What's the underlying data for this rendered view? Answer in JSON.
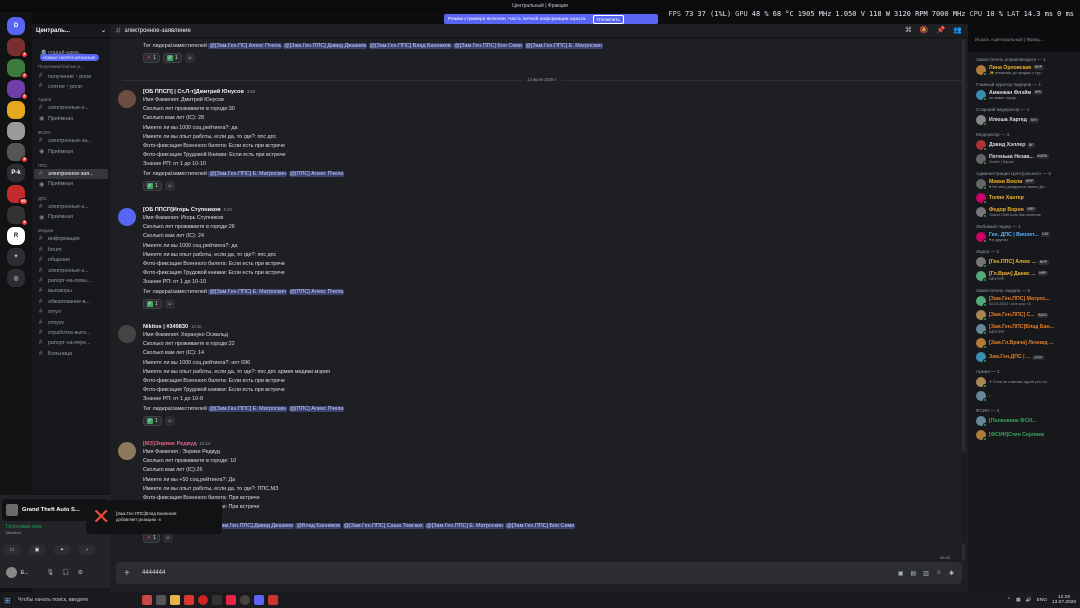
{
  "window": {
    "title": "Центральный | Фракции"
  },
  "overlay": {
    "fps_label": "FPS",
    "fps": "73",
    "fps_low": "37 (1%L)",
    "gpu_label": "GPU",
    "gpu_load": "48 %",
    "gpu_temp": "68 °C",
    "gpu_clock": "1905 MHz",
    "gpu_volt": "1.050 V",
    "gpu_power": "118 W",
    "gpu_rpm": "3120 RPM",
    "gpu_mem": "7000 MHz",
    "cpu_label": "CPU",
    "cpu_load": "10 %",
    "lat_label": "LAT",
    "lat": "14.3 ms",
    "lat2": "0 ms"
  },
  "streamer_notice": {
    "text": "Режим стримера включен. Часть личной информации скрыта.",
    "button": "Отключить"
  },
  "servers": [
    {
      "label": "D",
      "color": "#5865f2",
      "badge": ""
    },
    {
      "label": "",
      "color": "#7a2f2f",
      "badge": "1"
    },
    {
      "label": "",
      "color": "#3d7a3d",
      "badge": "1"
    },
    {
      "label": "",
      "color": "#6f3ea8",
      "badge": "8"
    },
    {
      "label": "",
      "color": "#e6a620",
      "badge": ""
    },
    {
      "label": "",
      "color": "#9a9a9a",
      "badge": ""
    },
    {
      "label": "",
      "color": "#555",
      "badge": "5"
    },
    {
      "label": "P-k",
      "color": "#2b2d31",
      "badge": ""
    },
    {
      "label": "",
      "color": "#c02b2b",
      "badge": "60"
    },
    {
      "label": "",
      "color": "#333",
      "badge": "1"
    },
    {
      "label": "R",
      "color": "#fff",
      "badge": ""
    },
    {
      "label": "+",
      "color": "#2b2d31",
      "badge": ""
    },
    {
      "label": "◎",
      "color": "#2b2d31",
      "badge": ""
    }
  ],
  "server_name": "Централь...",
  "new_unread": "НОВЫЕ НЕПРОЧИТАННЫЕ",
  "channel_list": [
    {
      "type": "ch",
      "label": "угадай-адми...",
      "icon": "🔎"
    },
    {
      "type": "cat",
      "label": "Получение/Снятие р..."
    },
    {
      "type": "ch",
      "label": "получение・роли"
    },
    {
      "type": "ch",
      "label": "снятие・роли"
    },
    {
      "type": "cat",
      "label": "Армия"
    },
    {
      "type": "ch",
      "label": "электронные-з..."
    },
    {
      "type": "ch",
      "label": "Приёмная",
      "icon": "◉"
    },
    {
      "type": "cat",
      "label": "ФСИН"
    },
    {
      "type": "ch",
      "label": "электронные-за..."
    },
    {
      "type": "ch",
      "label": "Приёмная",
      "icon": "◉"
    },
    {
      "type": "cat",
      "label": "ППС"
    },
    {
      "type": "ch",
      "label": "электронное-зая...",
      "active": true
    },
    {
      "type": "ch",
      "label": "Приёмная",
      "icon": "◉"
    },
    {
      "type": "cat",
      "label": "ДПС"
    },
    {
      "type": "ch",
      "label": "электронные-з..."
    },
    {
      "type": "ch",
      "label": "Приёмная",
      "icon": "◉"
    },
    {
      "type": "cat",
      "label": "Медики"
    },
    {
      "type": "ch",
      "label": "информация"
    },
    {
      "type": "ch",
      "label": "forum"
    },
    {
      "type": "ch",
      "label": "общение"
    },
    {
      "type": "ch",
      "label": "электронные-з..."
    },
    {
      "type": "ch",
      "label": "рапорт-на-повы..."
    },
    {
      "type": "ch",
      "label": "выговоры"
    },
    {
      "type": "ch",
      "label": "обжалование-в..."
    },
    {
      "type": "ch",
      "label": "отгул"
    },
    {
      "type": "ch",
      "label": "отпуск"
    },
    {
      "type": "ch",
      "label": "отработка-выго..."
    },
    {
      "type": "ch",
      "label": "рапорт-на-пере..."
    },
    {
      "type": "ch",
      "label": "Больница"
    }
  ],
  "channel": {
    "name": "электронное-заявление",
    "search_placeholder": "Искать «Центральный | Фракц..."
  },
  "date_separator": "13 июля 2026 г.",
  "partial_top": {
    "lead": "Тег лидера/заместителей",
    "mentions": [
      "@[Зам.Ген.ПС] Алекс Пчела",
      "@[Зам.Ген.ППС] Давид Джазиев",
      "@[Зам.Ген.ППС] Влад Банников",
      "@[Зам.Ген.ППС] Боо Сими",
      "@[Зам.Ген.ППС] Е. Матроскин"
    ]
  },
  "messages": [
    {
      "author": "[ОБ ППСП] | Ст.Л-т]Дмитрий Юнусов",
      "time": "3:55",
      "author_color": "#f2f3f5",
      "lines": [
        "Имя Фамилия: Дмитрий Юнусов",
        "Сколько лет проживаете в городе:30",
        "Сколько вам лет (IC): 28",
        "Имеете ли вы 1000 соц.рейтинга?: да",
        "Имеете ли вы опыт работы, если да, то где?:   ппс дпс",
        "Фото-фиксация Военного билета: Если есть при встрече",
        "Фото-фиксация Трудовой Книжки: Если есть при встрече",
        "Знание РП: от 1 до 10-10"
      ],
      "tag_line": "Тег лидера/заместителей",
      "mentions": [
        "@[Зам.Ген.ППС] Е. Матроскин",
        "@[ППС] Алекс Пчела"
      ],
      "reactions": [
        {
          "emoji": "✓",
          "count": "1",
          "mine": false
        }
      ]
    },
    {
      "author": "[ОБ ППСП]Игорь Ступников",
      "time": "5:20",
      "author_color": "#f2f3f5",
      "lines": [
        "Имя Фамилия: Игорь Ступников",
        "Сколько лет проживаете в городе:26",
        "Сколько вам лет (IC): 24",
        "Имеете ли вы 1000 соц.рейтинга?: да",
        "Имеете ли вы опыт работы, если да, то где?:   ппс дпс",
        "Фото-фиксация Военного билета: Если есть при встрече",
        "Фото-фиксация Трудовой книжки: Если есть при встрече",
        "Знание РП: от 1 до 10-10"
      ],
      "tag_line": "Тег лидера/заместителей",
      "mentions": [
        "@[Зам.Ген.ППС] Е. Матроскин",
        "@[ППС] Алекс Пчела"
      ],
      "reactions": [
        {
          "emoji": "✓",
          "count": "1",
          "mine": false
        }
      ]
    },
    {
      "author": "Nikitos | #349830",
      "time": "10:10",
      "author_color": "#f2f3f5",
      "lines": [
        "Имя Фамилия: Херануко Освальд",
        "Сколько лет проживаете в городе:22",
        "Сколько вам лет (IC): 14",
        "Имеете ли вы 1000 соц.рейтинга?: нет 696",
        "Имеете ли вы опыт работы, если да, то где?:   ппс дпс армия медики мэрия",
        "Фото-фиксация Военного билета: Если есть при встрече",
        "Фото-фиксация Трудовой книжки: Если есть при встрече",
        "Знание РП: от 1 до 10-8"
      ],
      "tag_line": "Тег лидера/заместителей",
      "mentions": [
        "@[Зам.Ген.ППС] Е. Матроскин",
        "@[ППС] Алекс Пчела"
      ],
      "reactions": [
        {
          "emoji": "✓",
          "count": "1",
          "mine": false
        }
      ]
    },
    {
      "author": "[МЗ]Энрике Редвуд",
      "time": "10:14",
      "author_color": "#e0658a",
      "lines": [
        "Имя Фамилия : Энрике Редвуд",
        "Сколько лет проживаете в городе: 10",
        "Сколько вам лет (IC):26",
        "Имеете ли вы +50 соц.рейтинга?: Да",
        "Имеете ли вы опыт работы, если да, то где?: ППС,МЗ",
        "Фото-фиксация Военного билета: При встрече",
        "Фото-фиксация Трудовой книжки: При встрече",
        ""
      ],
      "tag_line": "",
      "mentions": [
        "@[Ген.ППС] Алекс Пчела",
        "@[Зам.Ген.ППС].Давид Джазиев",
        "@Влад Банников",
        "@[Зам.Ген.ППС] Саша Томских",
        "@[Зам.Ген.ППС] Е. Матроскин",
        "@[Зам.Ген.ППС] Боо Сими"
      ],
      "reactions": [
        {
          "emoji": "✗",
          "count": "1",
          "mine": false
        }
      ]
    }
  ],
  "top_reactions": [
    {
      "emoji": "✗",
      "count": "1"
    },
    {
      "emoji": "✓",
      "count": "1"
    }
  ],
  "composer": {
    "value": "4444444"
  },
  "scroll_time": "46:00",
  "member_groups": [
    {
      "title": "Заместитель управляющего — 1",
      "members": [
        {
          "name": "Лина Орловская",
          "sub": "✨ активные до продаж с тур...",
          "color": "#f0b232",
          "tag": "NRP"
        }
      ]
    },
    {
      "title": "Главный куратор лидеров — 1",
      "members": [
        {
          "name": "Аманжан Флэйм",
          "sub": "он живет город",
          "color": "#dbdee1",
          "tag": "APK"
        }
      ]
    },
    {
      "title": "Старший модератор — 1",
      "members": [
        {
          "name": "Илюша Харгед",
          "sub": "",
          "color": "#dbdee1",
          "tag": "SKY"
        }
      ]
    },
    {
      "title": "Модератор — 2",
      "members": [
        {
          "name": "Дэвид Хэллер",
          "sub": "",
          "color": "#dbdee1",
          "tag": "BF"
        },
        {
          "name": "Петенька Незав...",
          "sub": "Soviet | Squad",
          "color": "#dbdee1",
          "tag": "AURA"
        }
      ]
    },
    {
      "title": "Администрация Центрального — 3",
      "members": [
        {
          "name": "Микки Вокли",
          "sub": "♥ Не могу дождаться своего Дн...",
          "color": "#f0b232",
          "tag": "NRP"
        },
        {
          "name": "Толян Хантер",
          "sub": "",
          "color": "#f0b232",
          "tag": ""
        },
        {
          "name": "Федор Ворон",
          "sub": "Grand Theft Auto San Andreas",
          "color": "#f0b232",
          "tag": "NRP"
        }
      ]
    },
    {
      "title": "Любимый лидер — 1",
      "members": [
        {
          "name": "Ген. ДПС | Виолет...",
          "sub": "♥ в другом",
          "color": "#5cb3ff",
          "tag": "CAT"
        }
      ]
    },
    {
      "title": "Лидер — 2",
      "members": [
        {
          "name": "[Ген.ППС] Алекс ...",
          "sub": "",
          "color": "#f0b232",
          "tag": "NRP"
        },
        {
          "name": "[Гл.Врач] Данис ...",
          "sub": "NEXTRP",
          "color": "#f0b232",
          "tag": "NRP"
        }
      ]
    },
    {
      "title": "Заместитель лидера — 5",
      "members": [
        {
          "name": "[Зам.Ген.ППС] Матрос...",
          "sub": "02.03.2022 i love you <3",
          "color": "#e67e22",
          "tag": ""
        },
        {
          "name": "[Зам.Ген.ППС] С...",
          "sub": "",
          "color": "#e67e22",
          "tag": "BUG!"
        },
        {
          "name": "[Зам.Ген.ППС]Влад Бан...",
          "sub": "NEXTRP",
          "color": "#e67e22",
          "tag": ""
        },
        {
          "name": "[Зам.Гл.Врача] Леонид ...",
          "sub": "",
          "color": "#e67e22",
          "tag": ""
        },
        {
          "name": "Зам.Ген.ДПС | ...",
          "sub": "",
          "color": "#e67e22",
          "tag": "خیابان"
        }
      ]
    },
    {
      "title": "Армия — 2",
      "members": [
        {
          "name": "",
          "sub": "✦ Если не отвечаю идите рос по...",
          "color": "#dbdee1",
          "tag": ""
        },
        {
          "name": "",
          "sub": "•",
          "color": "#dbdee1",
          "tag": ""
        }
      ]
    },
    {
      "title": "ФСИН — 4",
      "members": [
        {
          "name": "[Полковник ФСИ...",
          "sub": "",
          "color": "#3ba55d",
          "tag": ""
        },
        {
          "name": "[ФСИН]Стин Серпаев",
          "sub": "",
          "color": "#3ba55d",
          "tag": ""
        }
      ]
    }
  ],
  "user_panel": {
    "game": "Grand Theft Auto S...",
    "voice_status": "Голосовая связ",
    "voice_server": "Madison",
    "username": "E..."
  },
  "toast": {
    "line1": "[Зам.Ген.ППС]Влад Банников",
    "line2": "добавляет реакцию -х"
  },
  "taskbar": {
    "search": "Чтобы начать поиск, введите",
    "lang": "ENG",
    "time": "12:29",
    "date": "13.07.2026"
  }
}
